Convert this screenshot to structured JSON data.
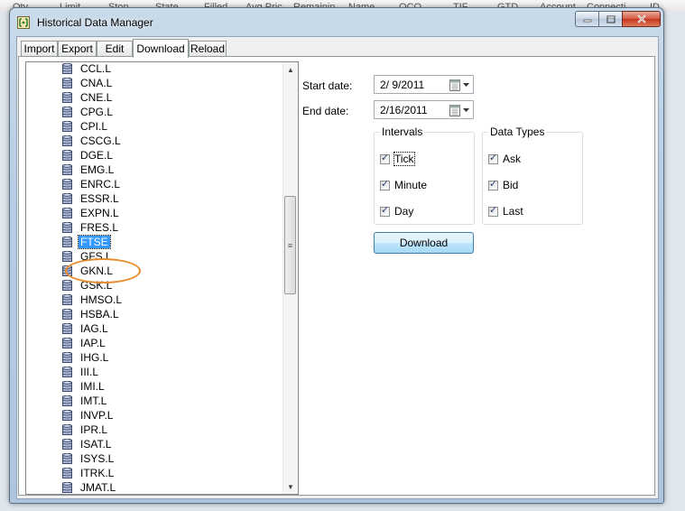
{
  "background_header": [
    "Qty",
    "Limit",
    "Stop",
    "State",
    "Filled",
    "Avg Pric",
    "Remainin",
    "Name",
    "OCO",
    "TIF",
    "GTD",
    "Account",
    "Connecti",
    "ID"
  ],
  "window": {
    "title": "Historical Data Manager"
  },
  "tabs": [
    {
      "label": "Import"
    },
    {
      "label": "Export"
    },
    {
      "label": "Edit"
    },
    {
      "label": "Download",
      "active": true
    },
    {
      "label": "Reload"
    }
  ],
  "tree": {
    "items": [
      "CCL.L",
      "CNA.L",
      "CNE.L",
      "CPG.L",
      "CPI.L",
      "CSCG.L",
      "DGE.L",
      "EMG.L",
      "ENRC.L",
      "ESSR.L",
      "EXPN.L",
      "FRES.L",
      "FTSE",
      "GFS.L",
      "GKN.L",
      "GSK.L",
      "HMSO.L",
      "HSBA.L",
      "IAG.L",
      "IAP.L",
      "IHG.L",
      "III.L",
      "IMI.L",
      "IMT.L",
      "INVP.L",
      "IPR.L",
      "ISAT.L",
      "ISYS.L",
      "ITRK.L",
      "JMAT.L"
    ],
    "selected": "FTSE"
  },
  "download": {
    "start_label": "Start date:",
    "start_value": "2/ 9/2011",
    "end_label": "End date:",
    "end_value": "2/16/2011",
    "intervals_title": "Intervals",
    "intervals": [
      {
        "label": "Tick",
        "checked": true
      },
      {
        "label": "Minute",
        "checked": true
      },
      {
        "label": "Day",
        "checked": true
      }
    ],
    "types_title": "Data Types",
    "types": [
      {
        "label": "Ask",
        "checked": true
      },
      {
        "label": "Bid",
        "checked": true
      },
      {
        "label": "Last",
        "checked": true
      }
    ],
    "button_label": "Download"
  },
  "colors": {
    "selection": "#3399ff",
    "annotation": "#e88b2a",
    "button_border": "#3c7fb1"
  }
}
